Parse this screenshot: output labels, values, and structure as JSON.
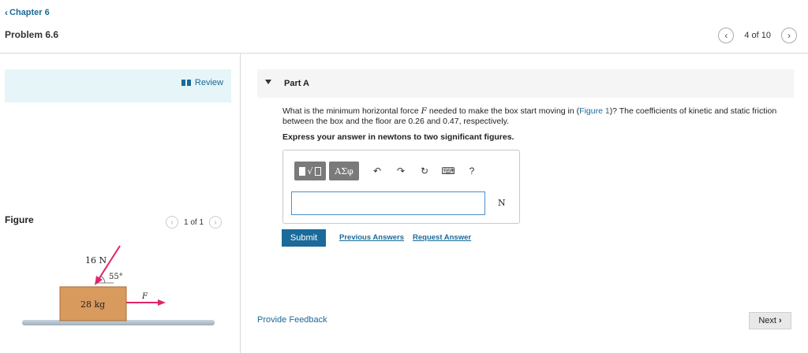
{
  "header": {
    "chapter_link": "Chapter 6",
    "problem_title": "Problem 6.6",
    "pager_count": "4 of 10"
  },
  "review": {
    "label": "Review"
  },
  "figure": {
    "label": "Figure",
    "pager_count": "1 of 1",
    "force_label": "16 N",
    "angle_label": "55°",
    "mass_label": "28 kg",
    "applied_force_label": "F",
    "colors": {
      "box": "#d99a5e",
      "force_arrow": "#e0246a",
      "floor": "#a9b9c6"
    }
  },
  "part": {
    "title": "Part A"
  },
  "question": {
    "text_before": "What is the minimum horizontal force ",
    "variable": "F",
    "text_middle": " needed to make the box start moving in (",
    "figure_link": "Figure 1",
    "text_after": ")? The coefficients of kinetic and static friction between the box and the floor are 0.26 and 0.47, respectively.",
    "instruction": "Express your answer in newtons to two significant figures."
  },
  "answer": {
    "toolbar_greek": "ΑΣφ",
    "value": "",
    "unit": "N"
  },
  "actions": {
    "submit": "Submit",
    "previous_answers": "Previous Answers",
    "request_answer": "Request Answer"
  },
  "footer": {
    "feedback": "Provide Feedback",
    "next": "Next"
  },
  "colors": {
    "accent": "#1a6a9a",
    "review_bg": "#e5f5f8",
    "part_bg": "#f5f5f5"
  }
}
